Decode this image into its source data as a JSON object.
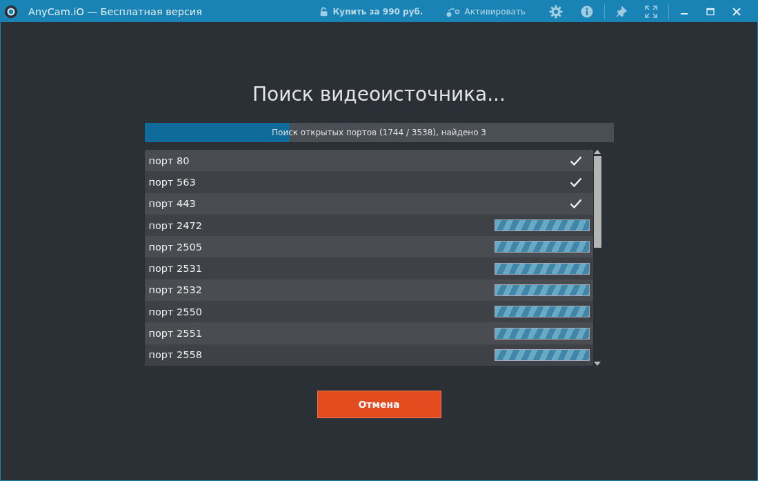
{
  "window": {
    "title": "AnyCam.iO — Бесплатная версия",
    "actions": [
      {
        "kind": "buy",
        "label": "Купить за 990 руб."
      },
      {
        "kind": "activate",
        "label": "Активировать"
      }
    ]
  },
  "dialog": {
    "title": "Поиск видеоисточника...",
    "progress": {
      "label": "Поиск открытых портов (1744 / 3538), найдено 3",
      "level": 0.31
    },
    "ports": [
      {
        "label": "порт 80",
        "kind": "found"
      },
      {
        "label": "порт 563",
        "kind": "found"
      },
      {
        "label": "порт 443",
        "kind": "found"
      },
      {
        "label": "порт 2472",
        "kind": "scanning"
      },
      {
        "label": "порт 2505",
        "kind": "scanning"
      },
      {
        "label": "порт 2531",
        "kind": "scanning"
      },
      {
        "label": "порт 2532",
        "kind": "scanning"
      },
      {
        "label": "порт 2550",
        "kind": "scanning"
      },
      {
        "label": "порт 2551",
        "kind": "scanning"
      },
      {
        "label": "порт 2558",
        "kind": "scanning"
      }
    ],
    "cancel": "Отмена"
  }
}
